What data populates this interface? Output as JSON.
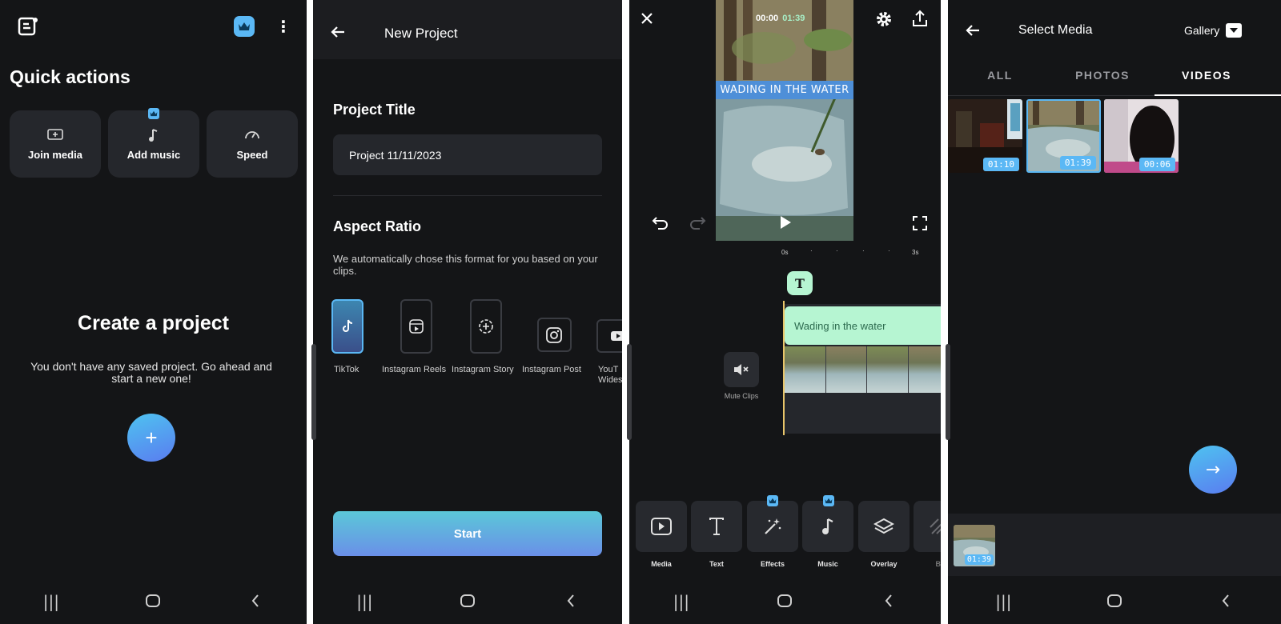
{
  "home": {
    "quick_actions_title": "Quick actions",
    "actions": [
      {
        "label": "Join media",
        "icon": "join-media-icon"
      },
      {
        "label": "Add music",
        "icon": "music-note-icon",
        "premium": true
      },
      {
        "label": "Speed",
        "icon": "speedometer-icon"
      }
    ],
    "empty_title": "Create a project",
    "empty_text": "You don't have any saved project. Go ahead and start a new one!",
    "add_button": "+",
    "accent": "#5bb8f5"
  },
  "new_project": {
    "title": "New Project",
    "project_title_label": "Project Title",
    "project_title_value": "Project 11/11/2023",
    "aspect_ratio_label": "Aspect Ratio",
    "aspect_ratio_hint": "We automatically chose this format for you based on your clips.",
    "ratios": [
      {
        "label": "TikTok",
        "selected": true
      },
      {
        "label": "Instagram Reels"
      },
      {
        "label": "Instagram Story"
      },
      {
        "label": "Instagram Post"
      },
      {
        "label": "YouT Wides"
      }
    ],
    "start_button": "Start"
  },
  "editor": {
    "current_time": "00:00",
    "total_time": "01:39",
    "overlay_text": "WADING IN THE WATER",
    "ruler": [
      "0s",
      "3s"
    ],
    "text_clip": "Wading in the water",
    "text_track_icon": "T",
    "mute_label": "Mute Clips",
    "tools": [
      {
        "label": "Media",
        "icon": "media-icon"
      },
      {
        "label": "Text",
        "icon": "text-icon"
      },
      {
        "label": "Effects",
        "icon": "magic-wand-icon",
        "premium": true
      },
      {
        "label": "Music",
        "icon": "music-note-icon",
        "premium": true
      },
      {
        "label": "Overlay",
        "icon": "layers-icon"
      },
      {
        "label": "Bl",
        "icon": "blend-icon"
      }
    ],
    "clip_color": "#b6f5d2"
  },
  "select_media": {
    "title": "Select Media",
    "source": "Gallery",
    "tabs": [
      "ALL",
      "PHOTOS",
      "VIDEOS"
    ],
    "active_tab": "VIDEOS",
    "videos": [
      {
        "duration": "01:10"
      },
      {
        "duration": "01:39",
        "selected": true
      },
      {
        "duration": "00:06"
      }
    ],
    "selected_tray": [
      {
        "duration": "01:39"
      }
    ],
    "next_button": "→"
  }
}
